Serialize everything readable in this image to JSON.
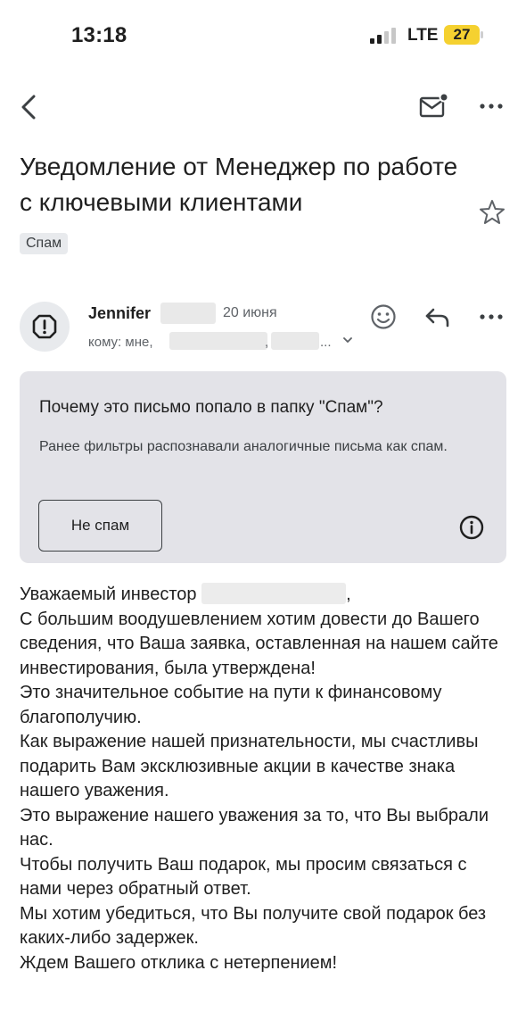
{
  "status_bar": {
    "time": "13:18",
    "network": "LTE",
    "battery": "27"
  },
  "email": {
    "subject": "Уведомление от Менеджер по работе с ключевыми клиентами",
    "label": "Спам",
    "sender": {
      "name": "Jennifer",
      "date": "20 июня",
      "recipients_prefix": "кому: мне,",
      "recipients_sep": ",",
      "recipients_more": "..."
    },
    "spam_notice": {
      "title": "Почему это письмо попало в папку \"Спам\"?",
      "text": "Ранее фильтры распознавали аналогичные письма как спам.",
      "not_spam_button": "Не спам"
    },
    "body": {
      "greeting_prefix": "Уважаемый инвестор",
      "greeting_suffix": ",",
      "paragraphs": [
        "С большим воодушевлением хотим довести до Вашего сведения, что Ваша заявка, оставленная на нашем сайте инвестирования, была утверждена!",
        "Это значительное событие на пути к финансовому благополучию.",
        "Как выражение нашей признательности, мы счастливы подарить Вам эксклюзивные акции в качестве знака нашего уважения.",
        "Это выражение нашего уважения за то, что Вы выбрали нас.",
        "Чтобы получить Ваш подарок, мы просим связаться с нами через обратный ответ.",
        "Мы хотим убедиться, что Вы получите свой подарок без каких-либо задержек.",
        "Ждем Вашего отклика с нетерпением!"
      ]
    }
  },
  "icons": {
    "back": "back-arrow-icon",
    "mail": "mark-unread-icon",
    "more": "more-horizontal-icon",
    "star": "star-icon",
    "avatar": "warning-octagon-icon",
    "emoji": "emoji-reaction-icon",
    "reply": "reply-icon",
    "info": "info-icon",
    "expand": "chevron-down-icon"
  },
  "colors": {
    "battery_fill": "#f5d130",
    "chip_bg": "#e8eaed",
    "notice_bg": "#e3e3e8"
  }
}
